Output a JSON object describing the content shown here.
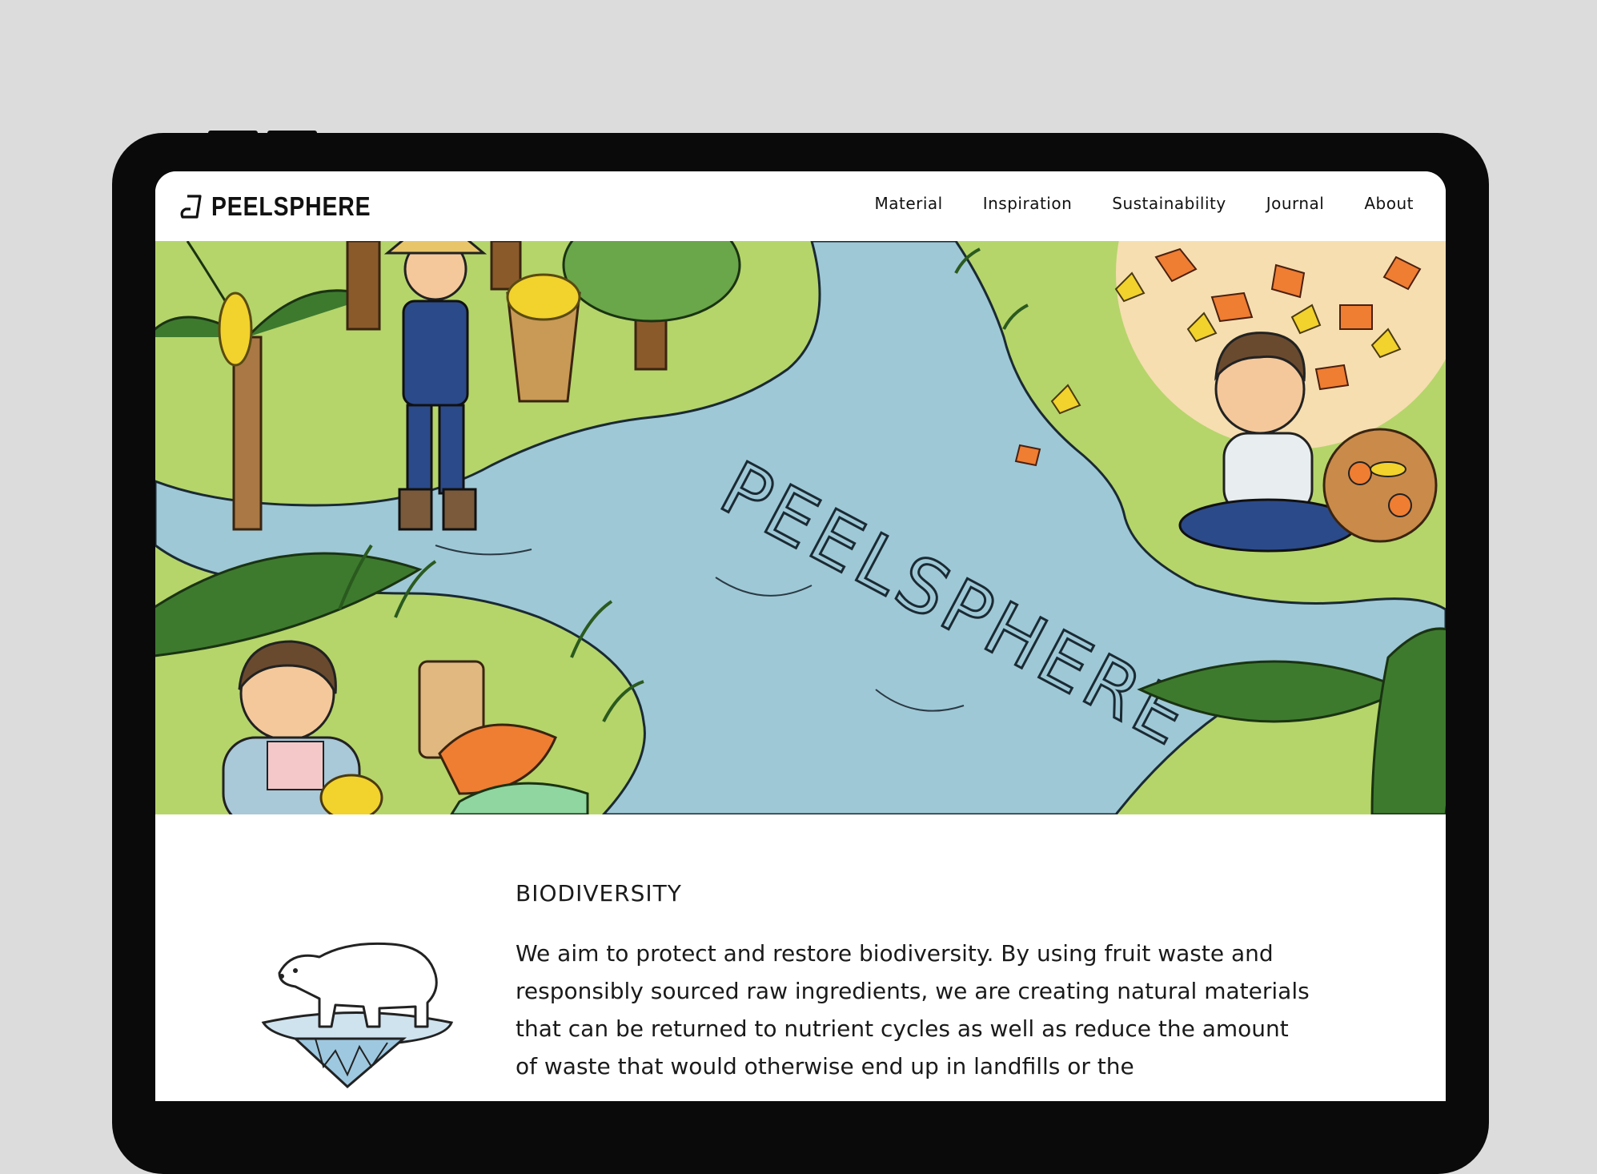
{
  "brand": {
    "name": "PEELSPHERE"
  },
  "nav": {
    "items": [
      {
        "label": "Material"
      },
      {
        "label": "Inspiration"
      },
      {
        "label": "Sustainability"
      },
      {
        "label": "Journal"
      },
      {
        "label": "About"
      }
    ]
  },
  "hero": {
    "watermark": "PEELSPHERE"
  },
  "section": {
    "title": "BIODIVERSITY",
    "body": "We aim to protect and restore biodiversity. By using fruit waste and responsibly sourced raw ingredients, we are creating natural materials that can be returned to nutrient cycles as well as reduce the amount of waste that would otherwise end up in landfills or the"
  },
  "colors": {
    "background": "#dcdcdc",
    "device": "#0a0a0a",
    "grass": "#b5d56a",
    "river": "#9ec8d6",
    "leaf": "#3d7a2e",
    "banana": "#f2d22c",
    "overalls": "#2b4a8a",
    "orange": "#ef7d32"
  }
}
